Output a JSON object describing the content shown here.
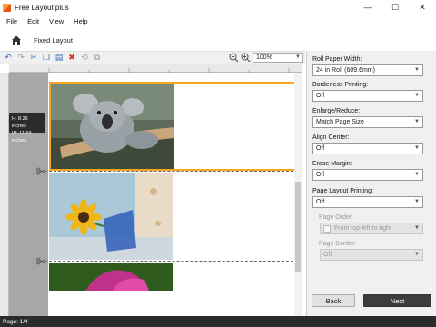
{
  "window": {
    "title": "Free Layout plus",
    "controls": {
      "minimize": "—",
      "maximize": "☐",
      "close": "✕"
    }
  },
  "menu": {
    "items": [
      "File",
      "Edit",
      "View",
      "Help"
    ]
  },
  "breadcrumb": {
    "label": "Fixed Layout"
  },
  "toolbar": {
    "zoom_value": "100%"
  },
  "canvas": {
    "size_tip_height": "H: 8.26 inches",
    "size_tip_width": "W: 11.69 inches"
  },
  "panel": {
    "roll_paper_width": {
      "label": "Roll Paper Width:",
      "value": "24 in Roll (609.6mm)"
    },
    "borderless_printing": {
      "label": "Borderless Printing:",
      "value": "Off"
    },
    "enlarge_reduce": {
      "label": "Enlarge/Reduce:",
      "value": "Match Page Size"
    },
    "align_center": {
      "label": "Align Center:",
      "value": "Off"
    },
    "erase_margin": {
      "label": "Erase Margin:",
      "value": "Off"
    },
    "page_layout_printing": {
      "label": "Page Layout Printing:",
      "value": "Off"
    },
    "page_order": {
      "label": "Page Order:",
      "value": "From top-left to right"
    },
    "page_border": {
      "label": "Page Border:",
      "value": "Off"
    },
    "back_label": "Back",
    "next_label": "Next"
  },
  "status": {
    "page": "Page: 1/4"
  },
  "colors": {
    "accent_border": "#f5a623",
    "next_button": "#3c3c3c",
    "status_bar": "#2b2b2b",
    "toolbar_icon": "#3a6fb0"
  }
}
